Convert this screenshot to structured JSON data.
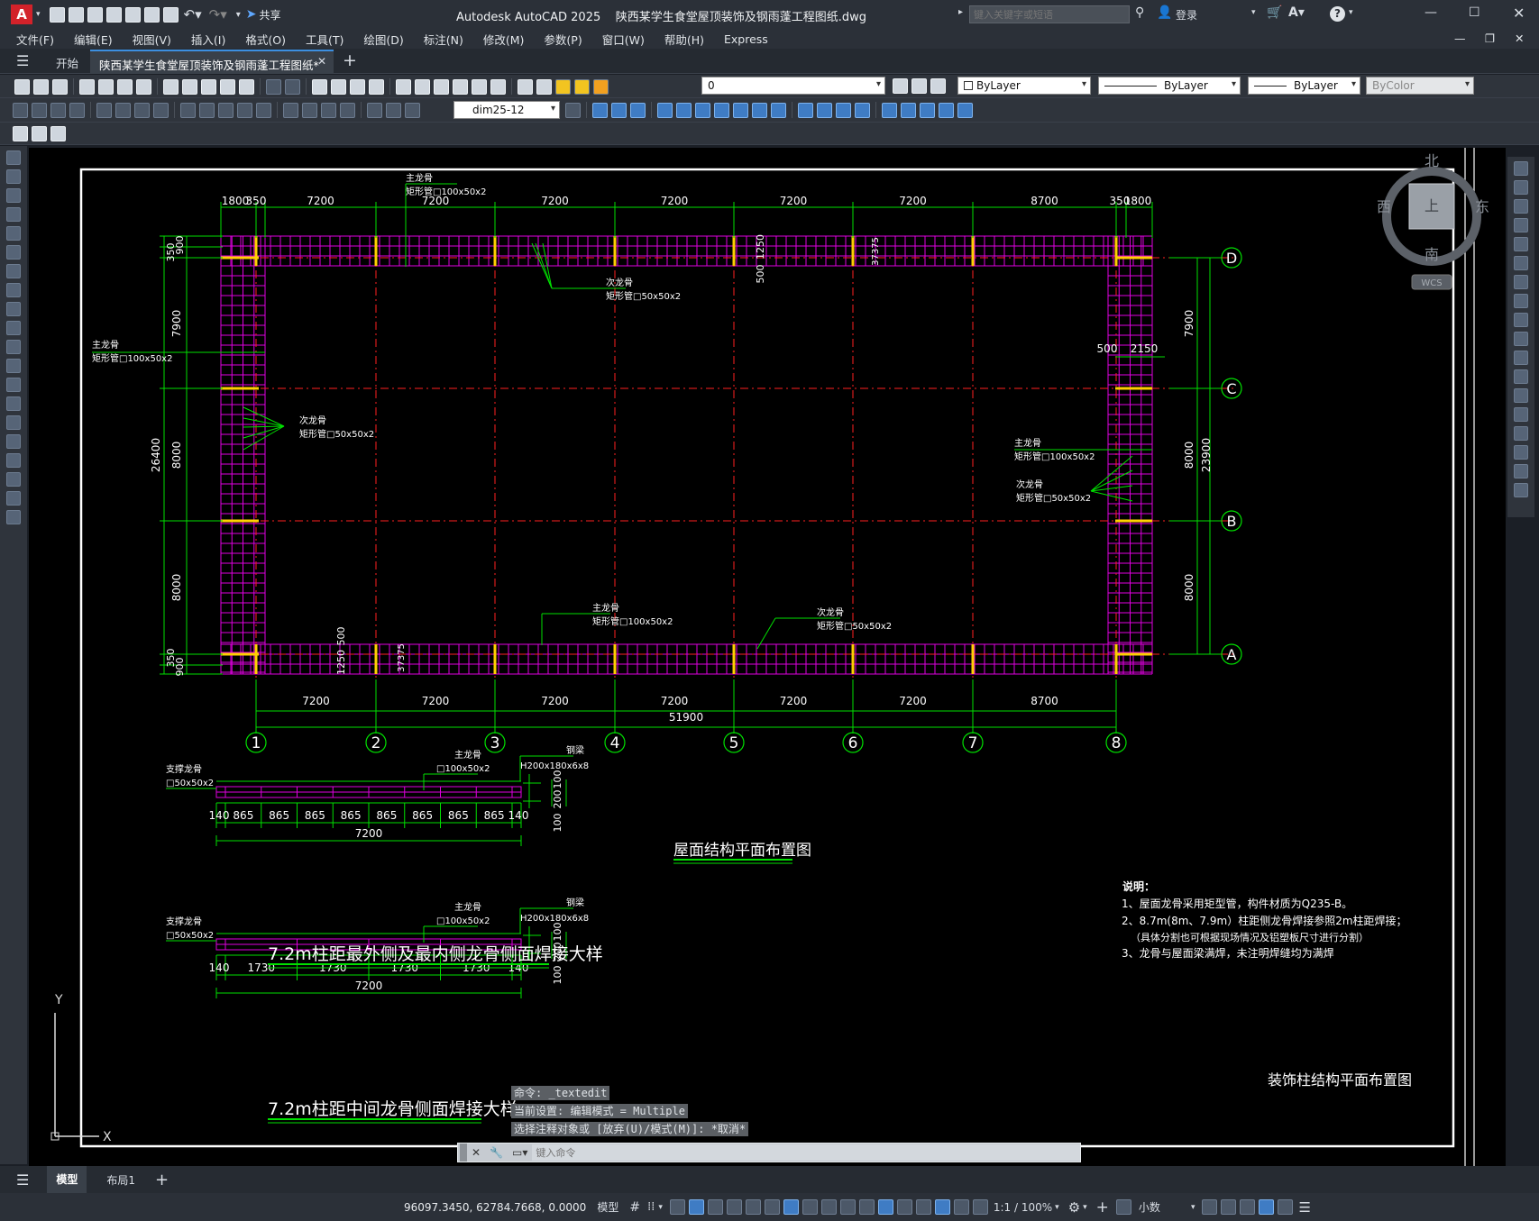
{
  "titlebar": {
    "app_letter": "A",
    "share": "共享",
    "title": "Autodesk AutoCAD 2025    陕西某学生食堂屋顶装饰及钢雨蓬工程图纸.dwg",
    "search_placeholder": "键入关键字或短语",
    "login": "登录"
  },
  "menu": [
    "文件(F)",
    "编辑(E)",
    "视图(V)",
    "插入(I)",
    "格式(O)",
    "工具(T)",
    "绘图(D)",
    "标注(N)",
    "修改(M)",
    "参数(P)",
    "窗口(W)",
    "帮助(H)",
    "Express"
  ],
  "tabs": {
    "start": "开始",
    "active": "陕西某学生食堂屋顶装饰及钢雨蓬工程图纸*"
  },
  "toolbar": {
    "layer_value": "0",
    "color": "ByLayer",
    "linetype": "ByLayer",
    "lineweight": "ByLayer",
    "plotstyle": "ByColor",
    "dimstyle": "dim25-12"
  },
  "viewcube": {
    "north": "北",
    "south": "南",
    "east": "东",
    "west": "西",
    "top": "上",
    "wcs": "WCS"
  },
  "drawing": {
    "top_dims": [
      "1800",
      "350",
      "7200",
      "7200",
      "7200",
      "7200",
      "7200",
      "7200",
      "8700",
      "350",
      "1800"
    ],
    "bottom_dims": [
      "7200",
      "7200",
      "7200",
      "7200",
      "7200",
      "7200",
      "8700"
    ],
    "total_bottom": "51900",
    "axes_num": [
      "1",
      "2",
      "3",
      "4",
      "5",
      "6",
      "7",
      "8"
    ],
    "axes_letter": [
      "D",
      "C",
      "B",
      "A"
    ],
    "left_dims": {
      "d1": "350",
      "d2": "900",
      "d3": "7900",
      "d4": "8000",
      "d5": "8000",
      "total": "26400",
      "d6": "350",
      "d7": "900"
    },
    "right_dims": {
      "d1": "7900",
      "d2": "8000",
      "d3": "8000",
      "total": "23900"
    },
    "inner_dims": {
      "a": "1250",
      "b": "500",
      "c": "37375",
      "d": "500",
      "e": "1250",
      "f": "37375",
      "g": "500",
      "h": "2150"
    },
    "labels": {
      "main_keel": "主龙骨",
      "main_keel_spec": "矩形管□100x50x2",
      "sec_keel": "次龙骨",
      "sec_keel_spec": "矩形管□50x50x2",
      "steel_beam": "钢梁",
      "beam_spec": "H200x180x6x8",
      "support_keel": "支撑龙骨",
      "support_spec": "□50x50x2",
      "main_spec_short": "□100x50x2"
    },
    "detail1": {
      "dims": [
        "140",
        "865",
        "865",
        "865",
        "865",
        "865",
        "865",
        "865",
        "865",
        "140"
      ],
      "total": "7200",
      "v": [
        "100",
        "200",
        "100"
      ],
      "title": "7.2m柱距最外侧及最内侧龙骨侧面焊接大样"
    },
    "detail2": {
      "dims": [
        "140",
        "1730",
        "1730",
        "1730",
        "1730",
        "140"
      ],
      "total": "7200",
      "v": [
        "100",
        "200",
        "100"
      ],
      "title": "7.2m柱距中间龙骨侧面焊接大样"
    },
    "plan_title": "屋面结构平面布置图",
    "notes": [
      "说明：",
      "1、屋面龙骨采用矩型管，构件材质为Q235-B。",
      "2、8.7m(8m、7.9m）柱距侧龙骨焊接参照2m柱距焊接；",
      "（具体分割也可根据现场情况及铝塑板尺寸进行分割）",
      "3、龙骨与屋面梁满焊，未注明焊缝均为满焊"
    ],
    "sheet_title": "装饰柱结构平面布置图",
    "ucs_x": "X",
    "ucs_y": "Y"
  },
  "cmd": {
    "h1": "命令: _textedit",
    "h2": "当前设置: 编辑模式 = Multiple",
    "h3": "选择注释对象或 [放弃(U)/模式(M)]: *取消*",
    "placeholder": "键入命令"
  },
  "layouts": {
    "model": "模型",
    "layout1": "布局1"
  },
  "status": {
    "coords": "96097.3450, 62784.7668, 0.0000",
    "model": "模型",
    "scale": "1:1 / 100%",
    "units": "小数"
  },
  "colors": {
    "grid": "#e000e0",
    "axis": "#ff2020",
    "dim": "#00e000",
    "text": "#ffffff",
    "column": "#ffd000"
  }
}
